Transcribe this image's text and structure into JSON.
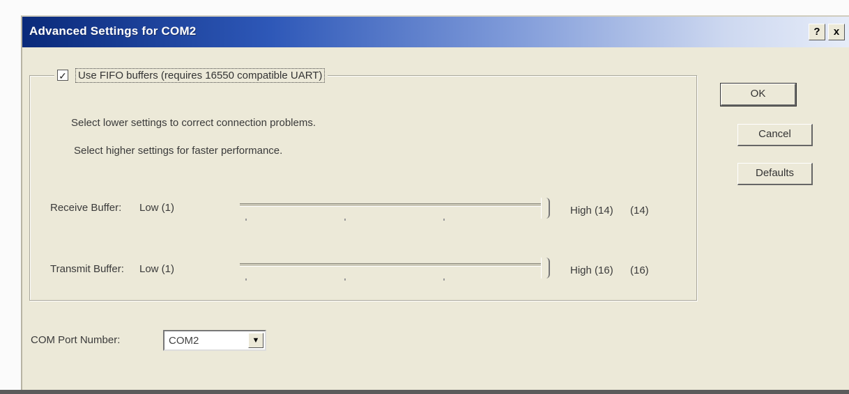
{
  "window": {
    "title": "Advanced Settings for COM2",
    "help_glyph": "?",
    "close_glyph": "x"
  },
  "fifo": {
    "checked": true,
    "check_glyph": "✓",
    "label": "Use FIFO buffers (requires 16550 compatible UART)"
  },
  "hints": {
    "lower": "Select lower settings to correct connection problems.",
    "higher": "Select higher settings for faster performance."
  },
  "receive": {
    "label": "Receive Buffer:",
    "low": "Low (1)",
    "high": "High (14)",
    "value": "(14)",
    "level": 1.0
  },
  "transmit": {
    "label": "Transmit Buffer:",
    "low": "Low (1)",
    "high": "High (16)",
    "value": "(16)",
    "level": 1.0
  },
  "buttons": {
    "ok": "OK",
    "cancel": "Cancel",
    "defaults": "Defaults"
  },
  "port": {
    "label": "COM Port Number:",
    "value": "COM2",
    "arrow_glyph": "▼"
  }
}
